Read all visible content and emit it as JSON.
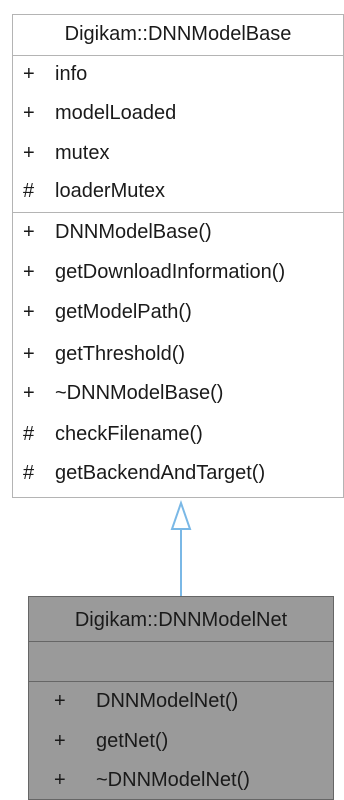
{
  "base": {
    "name": "Digikam::DNNModelBase",
    "attributes": [
      {
        "vis": "+",
        "name": "info"
      },
      {
        "vis": "+",
        "name": "modelLoaded"
      },
      {
        "vis": "+",
        "name": "mutex"
      },
      {
        "vis": "#",
        "name": "loaderMutex"
      }
    ],
    "methods": [
      {
        "vis": "+",
        "name": "DNNModelBase()"
      },
      {
        "vis": "+",
        "name": "getDownloadInformation()"
      },
      {
        "vis": "+",
        "name": "getModelPath()"
      },
      {
        "vis": "+",
        "name": "getThreshold()"
      },
      {
        "vis": "+",
        "name": "~DNNModelBase()"
      },
      {
        "vis": "#",
        "name": "checkFilename()"
      },
      {
        "vis": "#",
        "name": "getBackendAndTarget()"
      }
    ]
  },
  "derived": {
    "name": "Digikam::DNNModelNet",
    "attributes": [],
    "methods": [
      {
        "vis": "+",
        "name": "DNNModelNet()"
      },
      {
        "vis": "+",
        "name": "getNet()"
      },
      {
        "vis": "+",
        "name": "~DNNModelNet()"
      }
    ]
  },
  "colors": {
    "inheritance_arrow": "#7ab8e6",
    "base_fill": "#ffffff",
    "base_border": "#b4b4b4",
    "derived_fill": "#9a9a9a",
    "derived_border": "#666666"
  }
}
